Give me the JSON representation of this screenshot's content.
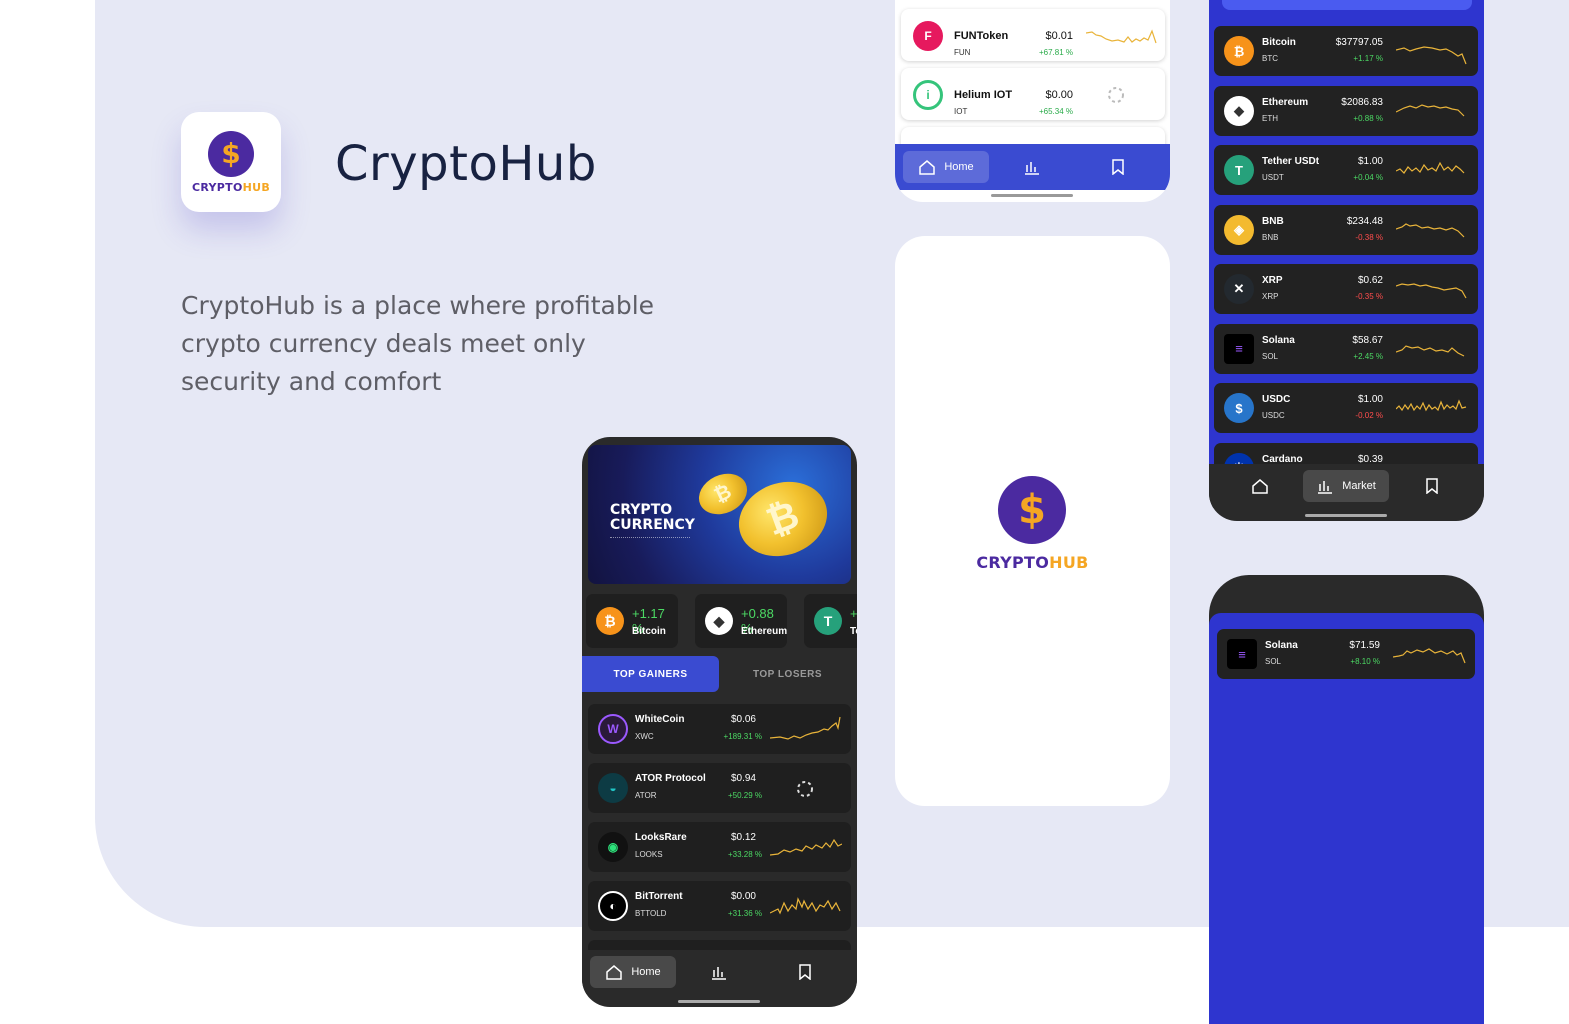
{
  "hero": {
    "title": "CryptoHub",
    "description": "CryptoHub is a place where profitable crypto currency deals meet only security and comfort",
    "logo_part1": "CRYPTO",
    "logo_part2": "HUB",
    "logo_symbol": "$"
  },
  "colors": {
    "background_panel": "#e6e8f5",
    "primary_blue": "#2e35cf",
    "accent_gold": "#f5a623",
    "logo_purple": "#4b2aa0",
    "positive": "#4cd964",
    "negative": "#ff4d4d",
    "sparkline": "#e9b43a"
  },
  "light_list": {
    "rows": [
      {
        "name": "FUNToken",
        "symbol": "FUN",
        "price": "$0.01",
        "change": "+67.81 %",
        "icon": "funtoken-icon"
      },
      {
        "name": "Helium IOT",
        "symbol": "IOT",
        "price": "$0.00",
        "change": "+65.34 %",
        "icon": "helium-icon"
      }
    ],
    "nav": {
      "home": "Home"
    }
  },
  "splash": {
    "logo_part1": "CRYPTO",
    "logo_part2": "HUB",
    "logo_symbol": "$"
  },
  "home_screen": {
    "banner": {
      "line1": "CRYPTO",
      "line2": "CURRENCY"
    },
    "tickers": [
      {
        "name": "Bitcoin",
        "change": "+1.17 %",
        "icon": "bitcoin-icon"
      },
      {
        "name": "Ethereum",
        "change": "+0.88 %",
        "icon": "ethereum-icon"
      },
      {
        "name": "Te",
        "change": "+",
        "icon": "tether-icon"
      }
    ],
    "tabs": {
      "active": "TOP GAINERS",
      "inactive": "TOP LOSERS"
    },
    "rows": [
      {
        "name": "WhiteCoin",
        "symbol": "XWC",
        "price": "$0.06",
        "change": "+189.31 %",
        "icon": "whitecoin-icon"
      },
      {
        "name": "ATOR Protocol",
        "symbol": "ATOR",
        "price": "$0.94",
        "change": "+50.29 %",
        "icon": "ator-icon"
      },
      {
        "name": "LooksRare",
        "symbol": "LOOKS",
        "price": "$0.12",
        "change": "+33.28 %",
        "icon": "looksrare-icon"
      },
      {
        "name": "BitTorrent",
        "symbol": "BTTOLD",
        "price": "$0.00",
        "change": "+31.36 %",
        "icon": "bittorrent-icon"
      }
    ],
    "nav": {
      "home": "Home"
    }
  },
  "market_screen": {
    "rows": [
      {
        "name": "Bitcoin",
        "symbol": "BTC",
        "price": "$37797.05",
        "change": "+1.17 %",
        "positive": true,
        "icon": "bitcoin-icon",
        "color": "#f7931a"
      },
      {
        "name": "Ethereum",
        "symbol": "ETH",
        "price": "$2086.83",
        "change": "+0.88 %",
        "positive": true,
        "icon": "ethereum-icon",
        "color": "#ffffff"
      },
      {
        "name": "Tether USDt",
        "symbol": "USDT",
        "price": "$1.00",
        "change": "+0.04 %",
        "positive": true,
        "icon": "tether-icon",
        "color": "#26a17b"
      },
      {
        "name": "BNB",
        "symbol": "BNB",
        "price": "$234.48",
        "change": "-0.38 %",
        "positive": false,
        "icon": "bnb-icon",
        "color": "#f3ba2f"
      },
      {
        "name": "XRP",
        "symbol": "XRP",
        "price": "$0.62",
        "change": "-0.35 %",
        "positive": false,
        "icon": "xrp-icon",
        "color": "#23292f"
      },
      {
        "name": "Solana",
        "symbol": "SOL",
        "price": "$58.67",
        "change": "+2.45 %",
        "positive": true,
        "icon": "solana-icon",
        "color": "#000000"
      },
      {
        "name": "USDC",
        "symbol": "USDC",
        "price": "$1.00",
        "change": "-0.02 %",
        "positive": false,
        "icon": "usdc-icon",
        "color": "#2775ca"
      },
      {
        "name": "Cardano",
        "symbol": "",
        "price": "$0.39",
        "change": "",
        "positive": true,
        "icon": "cardano-icon",
        "color": "#0033ad"
      }
    ],
    "nav": {
      "market": "Market"
    }
  },
  "watchlist_screen": {
    "rows": [
      {
        "name": "Solana",
        "symbol": "SOL",
        "price": "$71.59",
        "change": "+8.10 %",
        "icon": "solana-icon"
      }
    ]
  }
}
